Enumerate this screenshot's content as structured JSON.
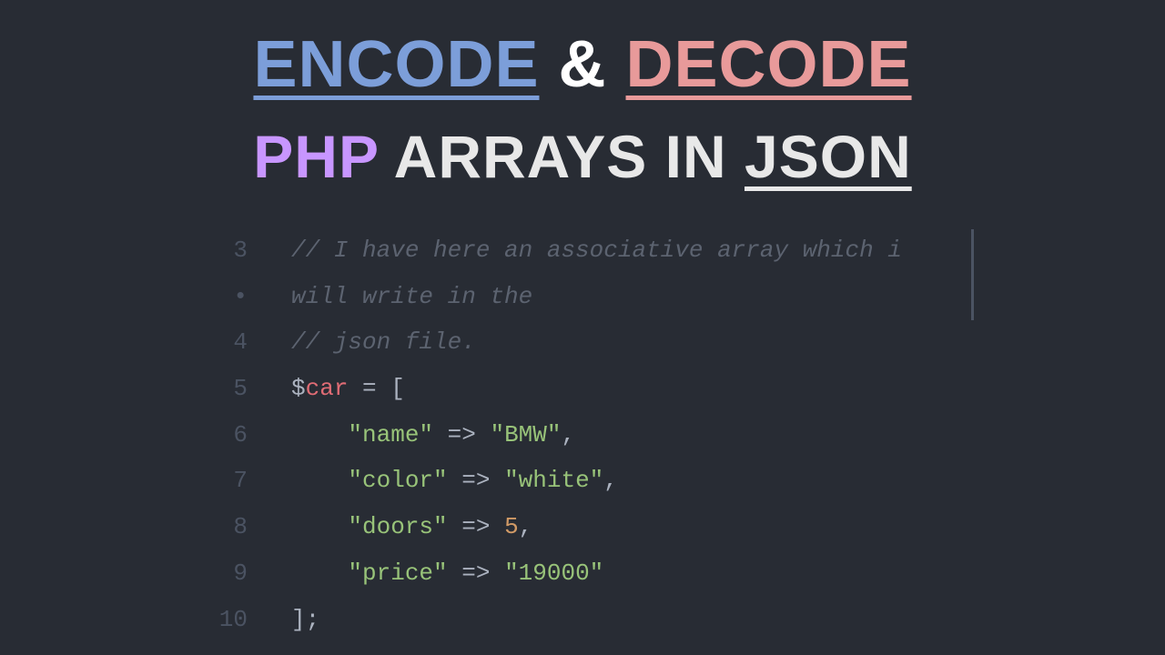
{
  "title": {
    "encode": "ENCODE",
    "amp": "&",
    "decode": "DECODE",
    "php": "PHP",
    "arrays_in": "ARRAYS IN",
    "json": "JSON"
  },
  "code": {
    "lines": [
      {
        "num": "3",
        "type": "comment",
        "text": "// I have here an associative array which i"
      },
      {
        "num": "•",
        "type": "comment",
        "text": "will write in the"
      },
      {
        "num": "4",
        "type": "comment",
        "text": "// json file."
      },
      {
        "num": "5",
        "type": "assign",
        "var": "car",
        "after": " = ["
      },
      {
        "num": "6",
        "type": "entry",
        "key": "\"name\"",
        "arrow": " => ",
        "val": "\"BMW\"",
        "val_type": "string",
        "comma": ","
      },
      {
        "num": "7",
        "type": "entry",
        "key": "\"color\"",
        "arrow": " => ",
        "val": "\"white\"",
        "val_type": "string",
        "comma": ","
      },
      {
        "num": "8",
        "type": "entry",
        "key": "\"doors\"",
        "arrow": " => ",
        "val": "5",
        "val_type": "number",
        "comma": ","
      },
      {
        "num": "9",
        "type": "entry",
        "key": "\"price\"",
        "arrow": " => ",
        "val": "\"19000\"",
        "val_type": "string",
        "comma": ""
      },
      {
        "num": "10",
        "type": "close",
        "text": "];"
      }
    ]
  }
}
